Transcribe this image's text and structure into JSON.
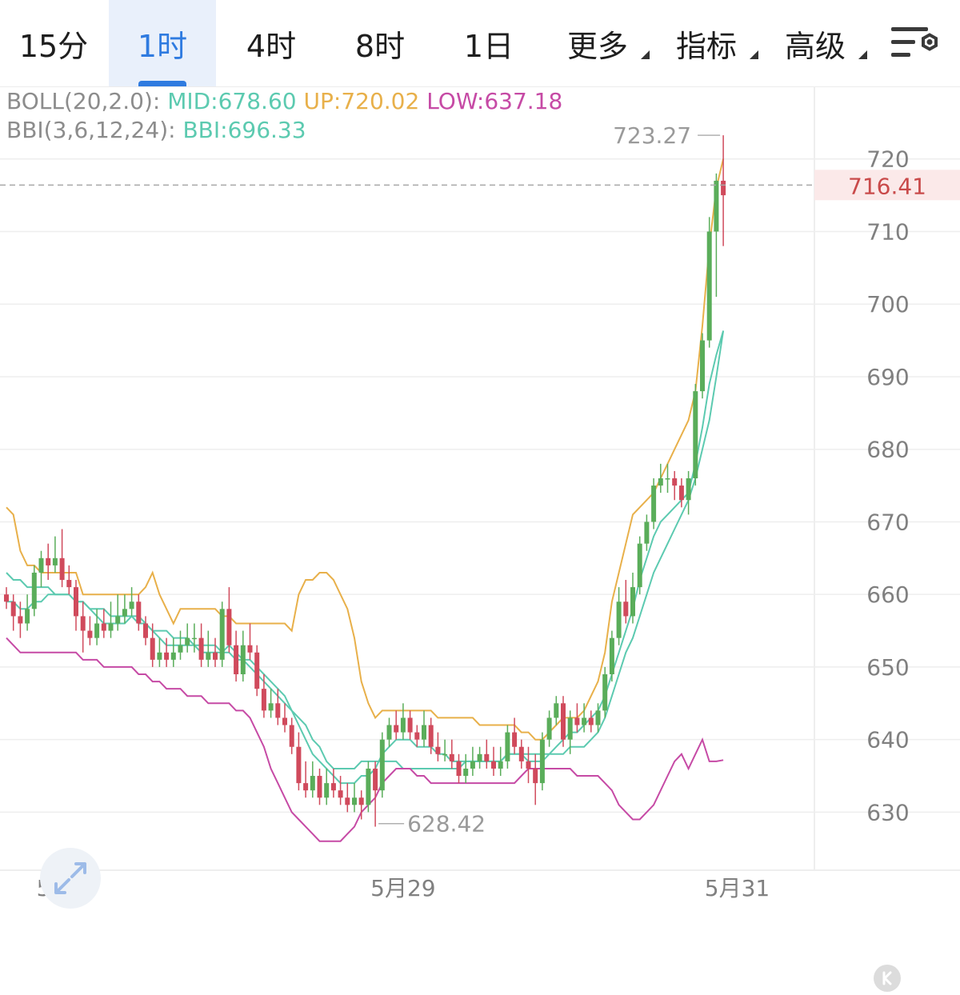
{
  "tabs": [
    {
      "label": "15分",
      "active": false,
      "caret": false
    },
    {
      "label": "1时",
      "active": true,
      "caret": false
    },
    {
      "label": "4时",
      "active": false,
      "caret": false
    },
    {
      "label": "8时",
      "active": false,
      "caret": false
    },
    {
      "label": "1日",
      "active": false,
      "caret": false
    },
    {
      "label": "更多",
      "active": false,
      "caret": true
    },
    {
      "label": "指标",
      "active": false,
      "caret": true
    },
    {
      "label": "高级",
      "active": false,
      "caret": true
    }
  ],
  "indicators": {
    "boll": {
      "name": "BOLL(20,2.0):",
      "mid": "MID:678.60",
      "up": "UP:720.02",
      "low": "LOW:637.18"
    },
    "bbi": {
      "name": "BBI(3,6,12,24):",
      "value": "BBI:696.33"
    }
  },
  "colors": {
    "rise": "#5aad5a",
    "fall": "#d04a5c",
    "mid": "#5ccab0",
    "up": "#e8b04a",
    "low": "#c64aa5",
    "grid": "#eeeeee",
    "axis_text": "#808080",
    "price_tag": "#c94a4a"
  },
  "icons": {
    "settings": "settings-sliders-icon",
    "expand": "expand-arrows-icon",
    "kline": "k-icon"
  },
  "chart_data": {
    "type": "candlestick",
    "interval": "1时",
    "y_ticks": [
      630,
      640,
      650,
      660,
      670,
      680,
      690,
      700,
      710,
      720
    ],
    "ylim": [
      622,
      730
    ],
    "x_ticks": [
      {
        "label": "5月27",
        "index": 9
      },
      {
        "label": "5月29",
        "index": 57
      },
      {
        "label": "5月31",
        "index": 105
      }
    ],
    "current_price": "716.41",
    "current_value": 716.41,
    "high_label": "723.27",
    "high_value": 723.27,
    "low_label": "628.42",
    "low_value": 628.42,
    "candles": [
      [
        660,
        659,
        661,
        658
      ],
      [
        659,
        657,
        660,
        655
      ],
      [
        657,
        656,
        659,
        654
      ],
      [
        656,
        658,
        660,
        655
      ],
      [
        658,
        663,
        664,
        657
      ],
      [
        663,
        665,
        666,
        661
      ],
      [
        665,
        664,
        667,
        662
      ],
      [
        664,
        665,
        668,
        663
      ],
      [
        665,
        662,
        669,
        661
      ],
      [
        662,
        661,
        664,
        660
      ],
      [
        661,
        657,
        662,
        655
      ],
      [
        657,
        655,
        659,
        652
      ],
      [
        655,
        654,
        657,
        653
      ],
      [
        654,
        656,
        658,
        653
      ],
      [
        656,
        655,
        658,
        654
      ],
      [
        655,
        656,
        659,
        654
      ],
      [
        656,
        657,
        660,
        655
      ],
      [
        657,
        658,
        660,
        656
      ],
      [
        658,
        659,
        661,
        657
      ],
      [
        659,
        656,
        660,
        655
      ],
      [
        656,
        654,
        657,
        653
      ],
      [
        654,
        651,
        656,
        650
      ],
      [
        651,
        652,
        654,
        650
      ],
      [
        652,
        651,
        654,
        650
      ],
      [
        651,
        652,
        654,
        650
      ],
      [
        652,
        653,
        655,
        651
      ],
      [
        653,
        654,
        656,
        652
      ],
      [
        654,
        654,
        656,
        652
      ],
      [
        654,
        651,
        656,
        650
      ],
      [
        651,
        652,
        655,
        650
      ],
      [
        652,
        651,
        654,
        650
      ],
      [
        651,
        658,
        659,
        650
      ],
      [
        658,
        653,
        661,
        652
      ],
      [
        653,
        649,
        655,
        648
      ],
      [
        649,
        653,
        655,
        648
      ],
      [
        653,
        652,
        656,
        651
      ],
      [
        652,
        647,
        653,
        646
      ],
      [
        647,
        644,
        649,
        643
      ],
      [
        644,
        645,
        647,
        643
      ],
      [
        645,
        643,
        647,
        642
      ],
      [
        643,
        642,
        645,
        641
      ],
      [
        642,
        639,
        643,
        638
      ],
      [
        639,
        634,
        641,
        633
      ],
      [
        634,
        633,
        637,
        632
      ],
      [
        633,
        635,
        637,
        632
      ],
      [
        635,
        632,
        636,
        631
      ],
      [
        632,
        634,
        636,
        631
      ],
      [
        634,
        633,
        636,
        632
      ],
      [
        633,
        632,
        635,
        631
      ],
      [
        632,
        631,
        634,
        630
      ],
      [
        631,
        632,
        634,
        630
      ],
      [
        632,
        631,
        633,
        629
      ],
      [
        631,
        636,
        637,
        630
      ],
      [
        636,
        633,
        637,
        628
      ],
      [
        633,
        640,
        641,
        632
      ],
      [
        640,
        642,
        643,
        639
      ],
      [
        642,
        641,
        644,
        640
      ],
      [
        641,
        643,
        645,
        640
      ],
      [
        643,
        641,
        644,
        640
      ],
      [
        641,
        640,
        642,
        639
      ],
      [
        640,
        642,
        644,
        639
      ],
      [
        642,
        639,
        643,
        638
      ],
      [
        639,
        638,
        641,
        637
      ],
      [
        638,
        638,
        640,
        637
      ],
      [
        638,
        637,
        640,
        636
      ],
      [
        637,
        635,
        638,
        634
      ],
      [
        635,
        636,
        638,
        634
      ],
      [
        636,
        637,
        639,
        635
      ],
      [
        637,
        638,
        639,
        636
      ],
      [
        638,
        637,
        640,
        636
      ],
      [
        637,
        636,
        639,
        635
      ],
      [
        636,
        637,
        639,
        635
      ],
      [
        637,
        641,
        642,
        636
      ],
      [
        641,
        639,
        643,
        638
      ],
      [
        639,
        637,
        640,
        636
      ],
      [
        637,
        636,
        639,
        634
      ],
      [
        636,
        634,
        638,
        631
      ],
      [
        634,
        640,
        641,
        633
      ],
      [
        640,
        643,
        644,
        639
      ],
      [
        643,
        645,
        646,
        642
      ],
      [
        645,
        640,
        646,
        639
      ],
      [
        640,
        643,
        644,
        638
      ],
      [
        643,
        642,
        645,
        641
      ],
      [
        642,
        643,
        645,
        641
      ],
      [
        643,
        642,
        644,
        641
      ],
      [
        642,
        644,
        645,
        641
      ],
      [
        644,
        649,
        650,
        643
      ],
      [
        649,
        654,
        655,
        648
      ],
      [
        654,
        659,
        661,
        653
      ],
      [
        659,
        657,
        662,
        656
      ],
      [
        657,
        661,
        663,
        656
      ],
      [
        661,
        667,
        668,
        660
      ],
      [
        667,
        670,
        671,
        666
      ],
      [
        670,
        675,
        676,
        669
      ],
      [
        675,
        676,
        678,
        674
      ],
      [
        676,
        676,
        678,
        674
      ],
      [
        676,
        675,
        677,
        673
      ],
      [
        675,
        673,
        676,
        672
      ],
      [
        673,
        676,
        677,
        671
      ],
      [
        676,
        688,
        689,
        675
      ],
      [
        688,
        695,
        696,
        687
      ],
      [
        695,
        710,
        712,
        694
      ],
      [
        710,
        717,
        718,
        701
      ],
      [
        717,
        715,
        723.27,
        708
      ]
    ],
    "boll_up": [
      672,
      671,
      666,
      664,
      664,
      663,
      663,
      663,
      663,
      663,
      663,
      660,
      660,
      660,
      660,
      660,
      660,
      660,
      660,
      660,
      661,
      663,
      660,
      658,
      656,
      658,
      658,
      658,
      658,
      658,
      658,
      657,
      657,
      656,
      656,
      656,
      656,
      656,
      656,
      656,
      656,
      655,
      660,
      662,
      662,
      663,
      663,
      662,
      660,
      658,
      654,
      648,
      645,
      643,
      644,
      644,
      644,
      644,
      644,
      644,
      644,
      644,
      643,
      643,
      643,
      643,
      643,
      643,
      642,
      642,
      642,
      642,
      642,
      642,
      641,
      641,
      640,
      640,
      641,
      642,
      643,
      643,
      643,
      644,
      646,
      648,
      652,
      659,
      663,
      667,
      671,
      672,
      673,
      674,
      676,
      678,
      680,
      682,
      684,
      688,
      697,
      708,
      716,
      720.02
    ],
    "boll_mid": [
      663,
      662,
      662,
      661,
      661,
      661,
      661,
      660,
      660,
      660,
      659,
      659,
      658,
      658,
      658,
      657,
      657,
      657,
      657,
      656,
      656,
      655,
      655,
      655,
      654,
      654,
      654,
      653,
      653,
      653,
      653,
      652,
      652,
      651,
      651,
      650,
      649,
      648,
      647,
      646,
      645,
      644,
      643,
      642,
      640,
      639,
      637,
      636,
      636,
      636,
      636,
      637,
      637,
      637,
      637,
      637,
      637,
      636,
      636,
      636,
      636,
      636,
      636,
      636,
      636,
      636,
      637,
      637,
      637,
      637,
      637,
      637,
      638,
      638,
      638,
      638,
      638,
      638,
      638,
      638,
      638,
      639,
      639,
      639,
      640,
      641,
      643,
      646,
      649,
      652,
      654,
      657,
      660,
      663,
      665,
      667,
      669,
      671,
      673,
      676,
      680,
      684,
      690,
      696.33
    ],
    "bbi": [
      659,
      659,
      658,
      658,
      659,
      659,
      660,
      660,
      660,
      660,
      659,
      659,
      658,
      657,
      656,
      656,
      656,
      656,
      657,
      657,
      656,
      655,
      654,
      653,
      653,
      653,
      653,
      653,
      652,
      652,
      652,
      652,
      653,
      652,
      651,
      651,
      650,
      649,
      648,
      647,
      646,
      644,
      642,
      640,
      638,
      637,
      636,
      635,
      634,
      634,
      634,
      635,
      635,
      636,
      638,
      639,
      640,
      640,
      640,
      639,
      639,
      639,
      638,
      638,
      637,
      637,
      637,
      637,
      637,
      637,
      637,
      637,
      638,
      638,
      638,
      637,
      637,
      637,
      638,
      639,
      640,
      641,
      641,
      642,
      643,
      644,
      646,
      649,
      652,
      655,
      658,
      662,
      665,
      668,
      670,
      671,
      672,
      673,
      674,
      678,
      683,
      689,
      693,
      696.33
    ],
    "boll_low": [
      654,
      653,
      652,
      652,
      652,
      652,
      652,
      652,
      652,
      652,
      652,
      651,
      651,
      651,
      650,
      650,
      650,
      650,
      650,
      649,
      649,
      648,
      648,
      647,
      647,
      647,
      646,
      646,
      646,
      645,
      645,
      645,
      645,
      644,
      644,
      643,
      641,
      639,
      636,
      634,
      632,
      630,
      629,
      628,
      627,
      626,
      626,
      626,
      626,
      627,
      628,
      630,
      631,
      632,
      634,
      635,
      636,
      636,
      636,
      635,
      635,
      634,
      634,
      634,
      634,
      634,
      634,
      634,
      634,
      634,
      634,
      634,
      634,
      634,
      635,
      636,
      636,
      636,
      636,
      636,
      636,
      636,
      635,
      635,
      635,
      635,
      634,
      633,
      631,
      630,
      629,
      629,
      630,
      631,
      633,
      635,
      637,
      638,
      636,
      638,
      640,
      637,
      637,
      637.18
    ]
  }
}
